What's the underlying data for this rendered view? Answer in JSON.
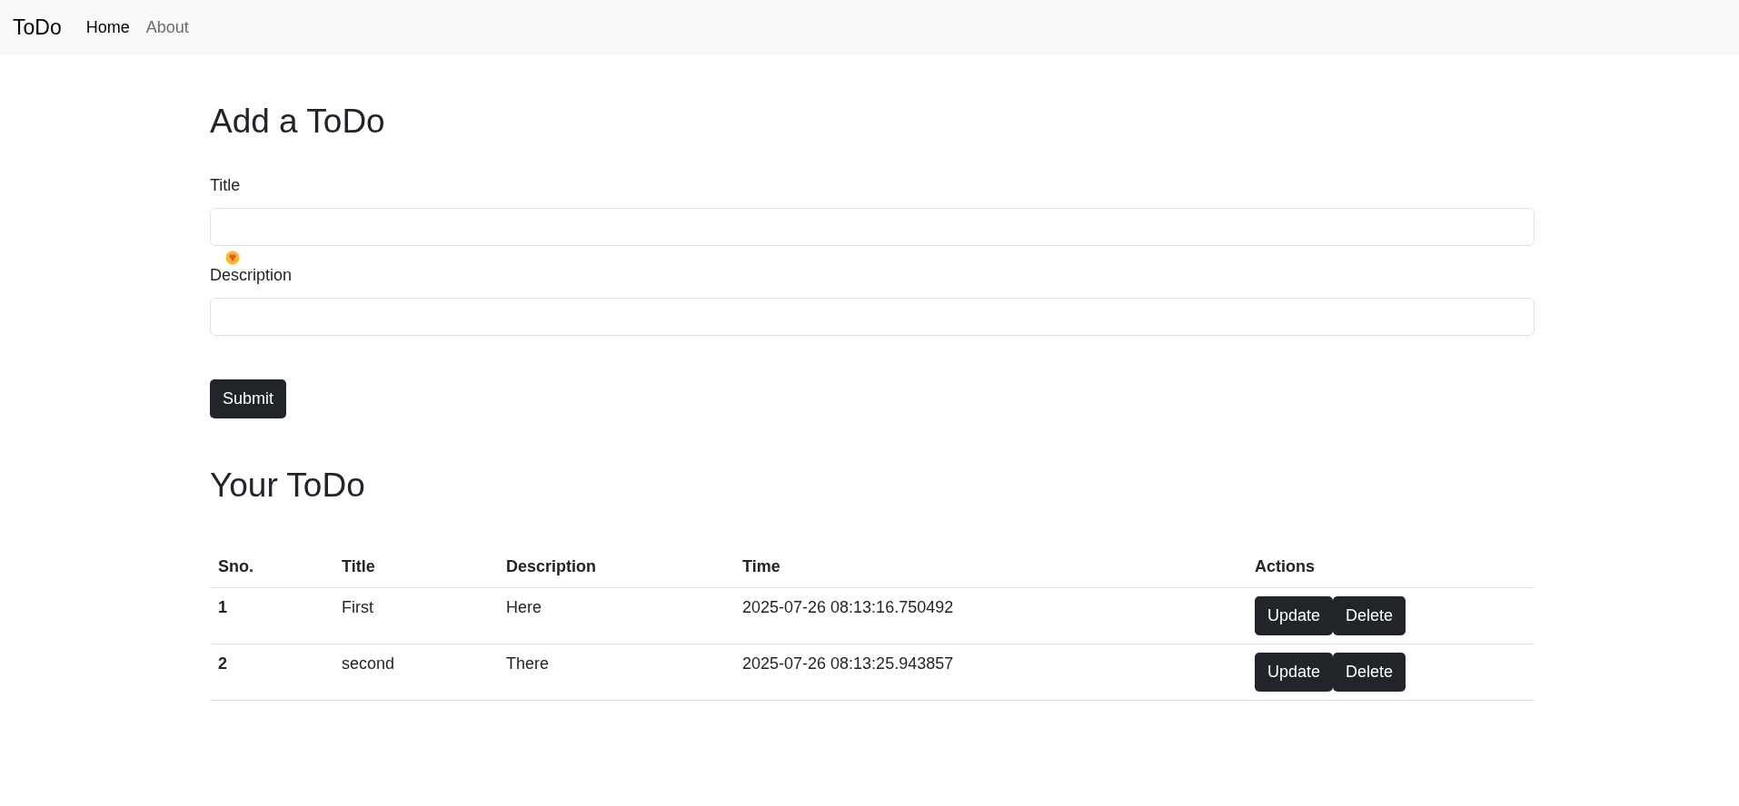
{
  "navbar": {
    "brand": "ToDo",
    "links": [
      {
        "label": "Home",
        "selected": true
      },
      {
        "label": "About",
        "selected": false
      }
    ]
  },
  "form": {
    "heading": "Add a ToDo",
    "fields": [
      {
        "label": "Title"
      },
      {
        "label": "Description",
        "badge": true
      }
    ],
    "submit": "Submit"
  },
  "list": {
    "heading": "Your ToDo",
    "columns": [
      "Sno.",
      "Title",
      "Description",
      "Time",
      "Actions"
    ],
    "rows": [
      {
        "sno": "1",
        "title": "First",
        "description": "Here",
        "time": "2025-07-26 08:13:16.750492",
        "actions": [
          "Update",
          "Delete"
        ]
      },
      {
        "sno": "2",
        "title": "second",
        "description": "There",
        "time": "2025-07-26 08:13:25.943857",
        "actions": [
          "Update",
          "Delete"
        ]
      }
    ]
  }
}
